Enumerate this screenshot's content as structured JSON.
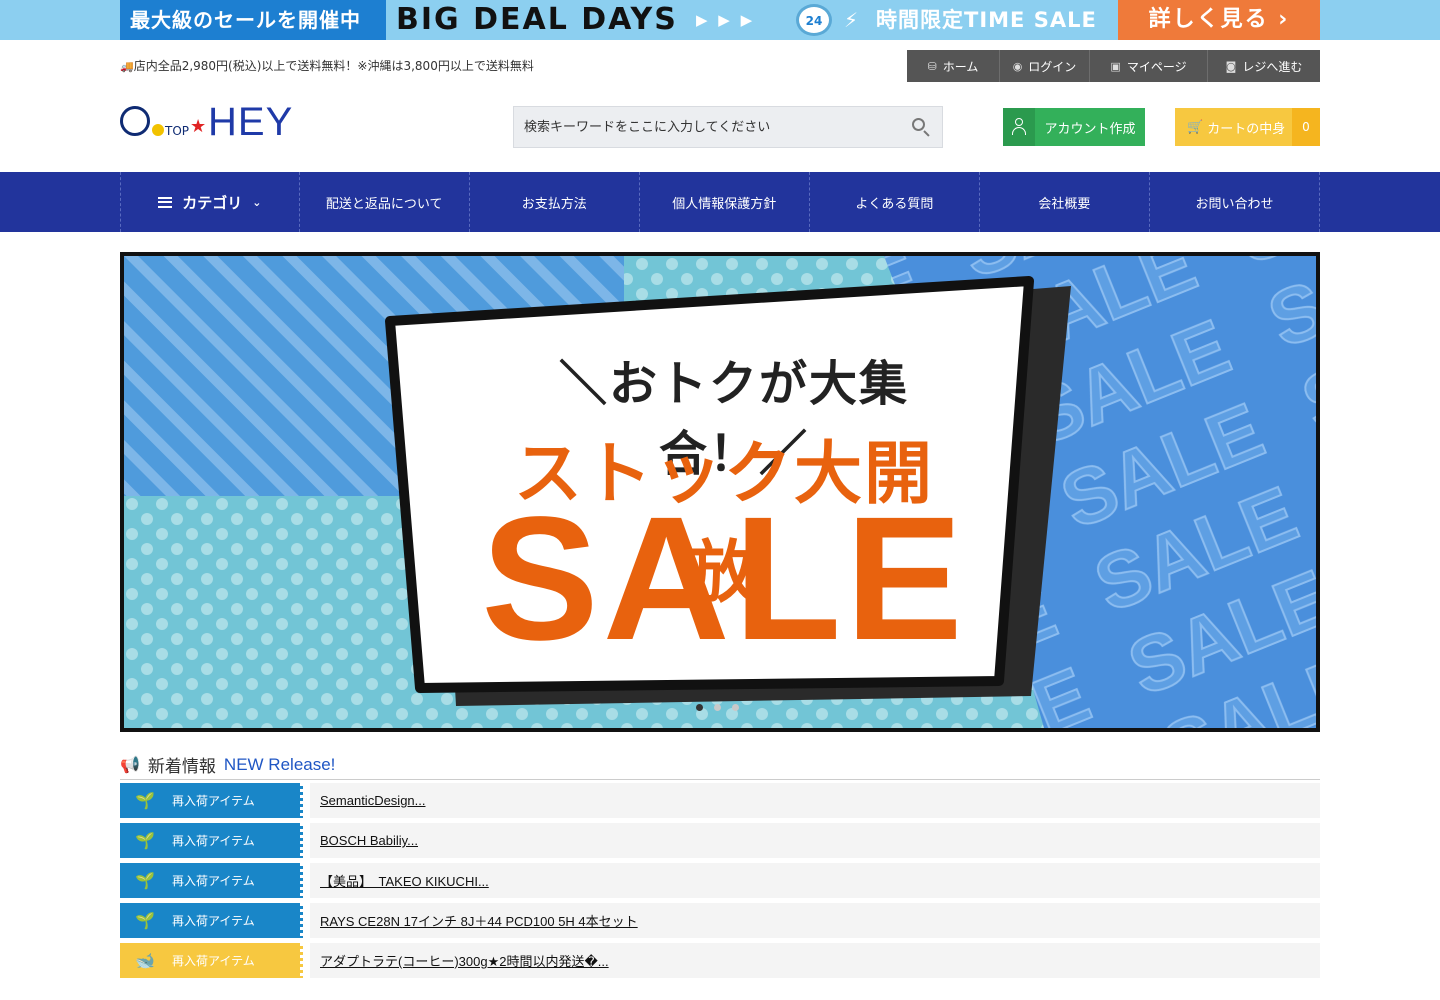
{
  "promo": {
    "left_text": "最大級のセールを開催中",
    "big_text": "BIG DEAL DAYS",
    "arrows": "▶ ▶ ▶",
    "clock_number": "24",
    "time_text": "時間限定TIME SALE",
    "cta_label": "詳しく見る ›"
  },
  "shipping_note": "店内全品2,980円(税込)以上で送料無料！※沖縄は3,800円以上で送料無料",
  "top_nav": [
    {
      "icon": "cubes-icon",
      "label": "ホーム",
      "width": 93
    },
    {
      "icon": "user-circle-icon",
      "label": "ログイン",
      "width": 90
    },
    {
      "icon": "id-card-icon",
      "label": "マイページ",
      "width": 118
    },
    {
      "icon": "money-icon",
      "label": "レジへ進む",
      "width": 112
    }
  ],
  "logo": {
    "top": "TOP",
    "name": "HEY"
  },
  "search": {
    "placeholder": "検索キーワードをここに入力してください"
  },
  "account_button": "アカウント作成",
  "cart": {
    "label": "カートの中身",
    "count": "0"
  },
  "main_nav": {
    "category": "カテゴリ",
    "items": [
      "配送と返品について",
      "お支払方法",
      "個人情報保護方針",
      "よくある質問",
      "会社概要",
      "お問い合わせ"
    ]
  },
  "hero": {
    "line1": "＼おトクが大集合！／",
    "line2": "ストック大開放",
    "line3": "SALE",
    "slides": 3,
    "active_slide": 1
  },
  "news": {
    "title": "新着情報",
    "subtitle": "NEW Release!",
    "items": [
      {
        "tag": "再入荷アイテム",
        "text": "SemanticDesign...",
        "color": "#1986c8"
      },
      {
        "tag": "再入荷アイテム",
        "text": "BOSCH Babiliy...",
        "color": "#1986c8"
      },
      {
        "tag": "再入荷アイテム",
        "text": "【美品】　TAKEO KIKUCHI...",
        "color": "#1986c8"
      },
      {
        "tag": "再入荷アイテム",
        "text": "RAYS CE28N 17インチ 8J＋44 PCD100 5H 4本セット",
        "color": "#1986c8"
      },
      {
        "tag": "再入荷アイテム",
        "text": "アダプトラテ(コーヒー)300g★2時間以内発送�...",
        "color": "#f7c840"
      }
    ]
  },
  "colors": {
    "nav_bg": "#22349c",
    "account_green": "#33b05a",
    "cart_yellow": "#f7c840",
    "promo_blue": "#8ccff0",
    "sale_orange": "#e8620e"
  }
}
